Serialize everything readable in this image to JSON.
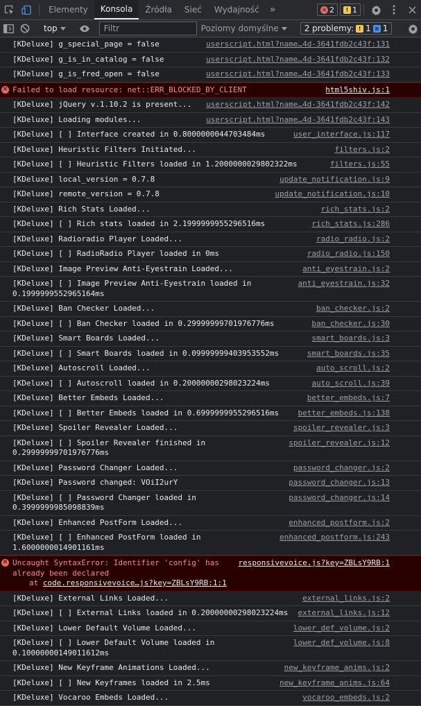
{
  "tabs": {
    "items": [
      "Elementy",
      "Konsola",
      "Źródła",
      "Sieć",
      "Wydajność"
    ],
    "more": "»",
    "error_count": "2",
    "warning_count": "1"
  },
  "toolbar": {
    "context": "top",
    "filter_placeholder": "Filtr",
    "levels": "Poziomy domyślne",
    "problems_label": "2 problemy:",
    "problems_warn": "1",
    "problems_info": "1"
  },
  "logs": [
    {
      "text": "[KDeluxe] g_special_page = false",
      "src": "userscript.html?name…4d-3641fdb2c43f:131"
    },
    {
      "text": "[KDeluxe] g_is_in_catalog = false",
      "src": "userscript.html?name…4d-3641fdb2c43f:132"
    },
    {
      "text": "[KDeluxe] g_is_fred_open = false",
      "src": "userscript.html?name…4d-3641fdb2c43f:133"
    },
    {
      "text": "Failed to load resource: net::ERR_BLOCKED_BY_CLIENT",
      "src": "html5shiv.js:1",
      "error": true
    },
    {
      "text": "[KDeluxe] jQuery v.1.10.2 is present...",
      "src": "userscript.html?name…4d-3641fdb2c43f:142"
    },
    {
      "text": "[KDeluxe] Loading modules...",
      "src": "userscript.html?name…4d-3641fdb2c43f:143"
    },
    {
      "text": "[KDeluxe] [ ] Interface created in 0.8000000044703484ms",
      "src": "user_interface.js:117"
    },
    {
      "text": "[KDeluxe] Heuristic Filters Initiated...",
      "src": "filters.js:2"
    },
    {
      "text": "[KDeluxe] [ ] Heuristic Filters loaded in 1.2000000029802322ms",
      "src": "filters.js:55"
    },
    {
      "text": "[KDeluxe] local_version = 0.7.8",
      "src": "update_notification.js:9"
    },
    {
      "text": "[KDeluxe] remote_version = 0.7.8",
      "src": "update_notification.js:10"
    },
    {
      "text": "[KDeluxe] Rich Stats Loaded...",
      "src": "rich_stats.js:2"
    },
    {
      "text": "[KDeluxe] [ ] Rich stats loaded in 2.1999999955296516ms",
      "src": "rich_stats.js:286"
    },
    {
      "text": "[KDeluxe] Radioradio Player Loaded...",
      "src": "radio_radio.js:2"
    },
    {
      "text": "[KDeluxe] [ ] RadioRadio Player loaded in 0ms",
      "src": "radio_radio.js:150"
    },
    {
      "text": "[KDeluxe] Image Preview Anti-Eyestrain Loaded...",
      "src": "anti_eyestrain.js:2"
    },
    {
      "text": "[KDeluxe] [ ] Image Preview Anti-Eyestrain loaded in\n0.1999999552965164ms",
      "src": "anti_eyestrain.js:32"
    },
    {
      "text": "[KDeluxe] Ban Checker Loaded...",
      "src": "ban_checker.js:2"
    },
    {
      "text": "[KDeluxe] [ ] Ban Checker loaded in 0.29999999701976776ms",
      "src": "ban_checker.js:30"
    },
    {
      "text": "[KDeluxe] Smart Boards Loaded...",
      "src": "smart_boards.js:3"
    },
    {
      "text": "[KDeluxe] [ ] Smart Boards loaded in 0.09999999403953552ms",
      "src": "smart_boards.js:35"
    },
    {
      "text": "[KDeluxe] Autoscroll Loaded...",
      "src": "auto_scroll.js:2"
    },
    {
      "text": "[KDeluxe] [ ] Autoscroll loaded in 0.20000000298023224ms",
      "src": "auto_scroll.js:39"
    },
    {
      "text": "[KDeluxe] Better Embeds Loaded...",
      "src": "better_embeds.js:7"
    },
    {
      "text": "[KDeluxe] [ ] Better Embeds loaded in 0.6999999955296516ms",
      "src": "better_embeds.js:138"
    },
    {
      "text": "[KDeluxe] Spoiler Revealer Loaded...",
      "src": "spoiler_revealer.js:3"
    },
    {
      "text": "[KDeluxe] [ ] Spoiler Revealer finished in\n0.29999999701976776ms",
      "src": "spoiler_revealer.js:12"
    },
    {
      "text": "[KDeluxe] Password Changer Loaded...",
      "src": "password_changer.js:2"
    },
    {
      "text": "[KDeluxe] Password changed: VOiI2urY",
      "src": "password_changer.js:13"
    },
    {
      "text": "[KDeluxe] [ ] Password Changer loaded in\n0.3999999985098839ms",
      "src": "password_changer.js:14"
    },
    {
      "text": "[KDeluxe] Enhanced PostForm Loaded...",
      "src": "enhanced_postform.js:2"
    },
    {
      "text": "[KDeluxe] [ ] Enhanced PostForm loaded in\n1.6000000014901161ms",
      "src": "enhanced_postform.js:243"
    },
    {
      "text": "Uncaught SyntaxError: Identifier 'config' has\nalready been declared",
      "src": "responsivevoice.js?key=ZBLsY9RB:1",
      "error": true,
      "stack_prefix": "at ",
      "stack_link": "code.responsivevoice…js?key=ZBLsY9RB:1:1"
    },
    {
      "text": "[KDeluxe] External Links Loaded...",
      "src": "external_links.js:2"
    },
    {
      "text": "[KDeluxe] [ ] External Links loaded in 0.20000000298023224ms",
      "src": "external_links.js:12"
    },
    {
      "text": "[KDeluxe] Lower Default Volume Loaded...",
      "src": "lower_def_volume.js:2"
    },
    {
      "text": "[KDeluxe] [ ] Lower Default Volume loaded in\n0.10000000149011612ms",
      "src": "lower_def_volume.js:8"
    },
    {
      "text": "[KDeluxe] New Keyframe Animations Loaded...",
      "src": "new_keyframe_anims.js:2"
    },
    {
      "text": "[KDeluxe] [ ] New Keyframes loaded in 2.5ms",
      "src": "new_keyframe_anims.js:64"
    },
    {
      "text": "[KDeluxe] Vocaroo Embeds Loaded...",
      "src": "vocaroo_embeds.js:2"
    }
  ]
}
